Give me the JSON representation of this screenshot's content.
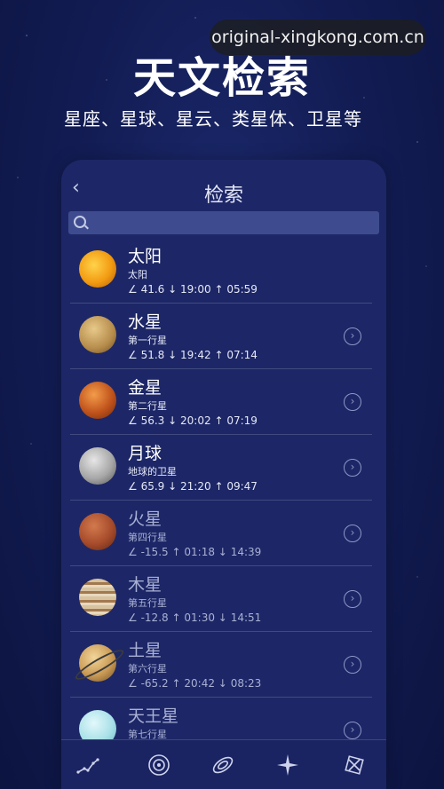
{
  "watermark": "original-xingkong.com.cn",
  "headline": "天文检索",
  "subline": "星座、星球、星云、类星体、卫星等",
  "nav": {
    "back_glyph": "‹",
    "title": "检索"
  },
  "search": {
    "placeholder": ""
  },
  "items": [
    {
      "name": "太阳",
      "sub": "太阳",
      "alt": "41.6",
      "t1": "19:00",
      "t2": "05:59",
      "d1": "↓",
      "d2": "↑"
    },
    {
      "name": "水星",
      "sub": "第一行星",
      "alt": "51.8",
      "t1": "19:42",
      "t2": "07:14",
      "d1": "↓",
      "d2": "↑"
    },
    {
      "name": "金星",
      "sub": "第二行星",
      "alt": "56.3",
      "t1": "20:02",
      "t2": "07:19",
      "d1": "↓",
      "d2": "↑"
    },
    {
      "name": "月球",
      "sub": "地球的卫星",
      "alt": "65.9",
      "t1": "21:20",
      "t2": "09:47",
      "d1": "↓",
      "d2": "↑"
    },
    {
      "name": "火星",
      "sub": "第四行星",
      "alt": "-15.5",
      "t1": "01:18",
      "t2": "14:39",
      "d1": "↑",
      "d2": "↓"
    },
    {
      "name": "木星",
      "sub": "第五行星",
      "alt": "-12.8",
      "t1": "01:30",
      "t2": "14:51",
      "d1": "↑",
      "d2": "↓"
    },
    {
      "name": "土星",
      "sub": "第六行星",
      "alt": "-65.2",
      "t1": "20:42",
      "t2": "08:23",
      "d1": "↑",
      "d2": "↓"
    },
    {
      "name": "天王星",
      "sub": "第七行星",
      "alt": "",
      "t1": "",
      "t2": "",
      "d1": "",
      "d2": ""
    }
  ],
  "tabs": [
    {
      "icon": "constellation-icon"
    },
    {
      "icon": "orbit-icon"
    },
    {
      "icon": "galaxy-icon"
    },
    {
      "icon": "star-icon"
    },
    {
      "icon": "satellite-icon"
    }
  ]
}
